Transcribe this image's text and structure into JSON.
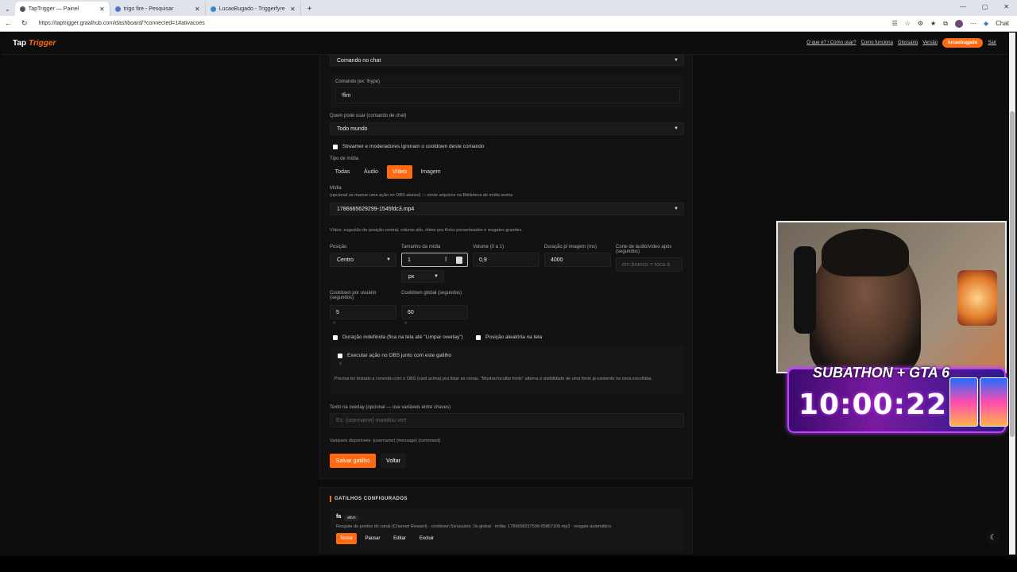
{
  "browser": {
    "tabs": [
      {
        "title": "TapTrigger — Painel",
        "active": true
      },
      {
        "title": "trigo fire - Pesquisar",
        "active": false
      },
      {
        "title": "LucaoBugado - Triggerfyre",
        "active": false
      }
    ],
    "url": "https://taptrigger.graalhub.com/dashboard/?connected=1#ativacoes",
    "chat_label": "Chat"
  },
  "nav": {
    "logo_main": "Tap",
    "logo_accent": "Trigger",
    "links": [
      "O que é? / Como usar?",
      "Como funciona",
      "Glossário",
      "Versão"
    ],
    "user": "lucaobugado",
    "logout": "Sair"
  },
  "form": {
    "trigger_type": "Comando no chat",
    "command_label": "Comando (ex: !hype)",
    "command_value": "!fim",
    "who_label": "Quem pode usar (comando de chat)",
    "who_value": "Todo mundo",
    "bypass_label": "Streamer e moderadores ignoram o cooldown deste comando",
    "media_type_label": "Tipo de mídia",
    "media_types": [
      "Todas",
      "Áudio",
      "Vídeo",
      "Imagem"
    ],
    "media_type_selected": "Vídeo",
    "media_label": "Mídia",
    "media_hint": "(opcional se marcar uma ação no OBS abaixo) — envie arquivos na Biblioteca de mídia acima",
    "media_value": "1786665629299-1545fdc3.mp4",
    "video_hint": "Vídeo: sugestão de posição central, volume alto, ótimo pra Kicks presenteados e resgates grandes.",
    "position_label": "Posição",
    "position_value": "Centro",
    "size_label": "Tamanho da mídia",
    "size_value": "1",
    "size_unit": "px",
    "volume_label": "Volume (0 a 1)",
    "volume_value": "0,9",
    "duration_label": "Duração p/ imagem (ms)",
    "duration_value": "4000",
    "cut_label": "Corte de áudio/vídeo após (segundos)",
    "cut_placeholder": "em branco = toca a",
    "cooldown_user_label": "Cooldown por usuário (segundos)",
    "cooldown_user_value": "5",
    "cooldown_global_label": "Cooldown global (segundos)",
    "cooldown_global_value": "60",
    "help_mark": "?",
    "indef_label": "Duração indefinida (fica na tela até \"Limpar overlay\")",
    "random_label": "Posição aleatória na tela",
    "obs_label": "Executar ação no OBS junto com este gatilho",
    "obs_hint": "Precisa ter testado a conexão com o OBS (card acima) pra listar as cenas. \"Mostrar/ocultar fonte\" alterna a visibilidade de uma fonte já existente na cena escolhida.",
    "overlay_text_label": "Texto na overlay (opcional — use variáveis entre chaves)",
    "overlay_text_placeholder": "Ex: {username} mandou ver!",
    "variables_hint": "Variáveis disponíveis: {username} {message} {command}",
    "save_button": "Salvar gatilho",
    "back_button": "Voltar"
  },
  "triggers": {
    "heading": "GATILHOS CONFIGURADOS",
    "items": [
      {
        "name": "fa",
        "status": "ativo",
        "desc": "Resgate de pontos do canal (Channel Reward) · cooldown 5s/usuário, 0s global · mídia: 1786658237598-65857106.mp3 · resgate automático",
        "actions": [
          "Testar",
          "Pausar",
          "Editar",
          "Excluir"
        ]
      }
    ]
  },
  "overlay": {
    "banner_title": "SUBATHON + GTA 6",
    "timer": "10:00:22"
  },
  "colors": {
    "accent": "#ff6a13",
    "background": "#0d0d0d",
    "panel": "#121212"
  }
}
